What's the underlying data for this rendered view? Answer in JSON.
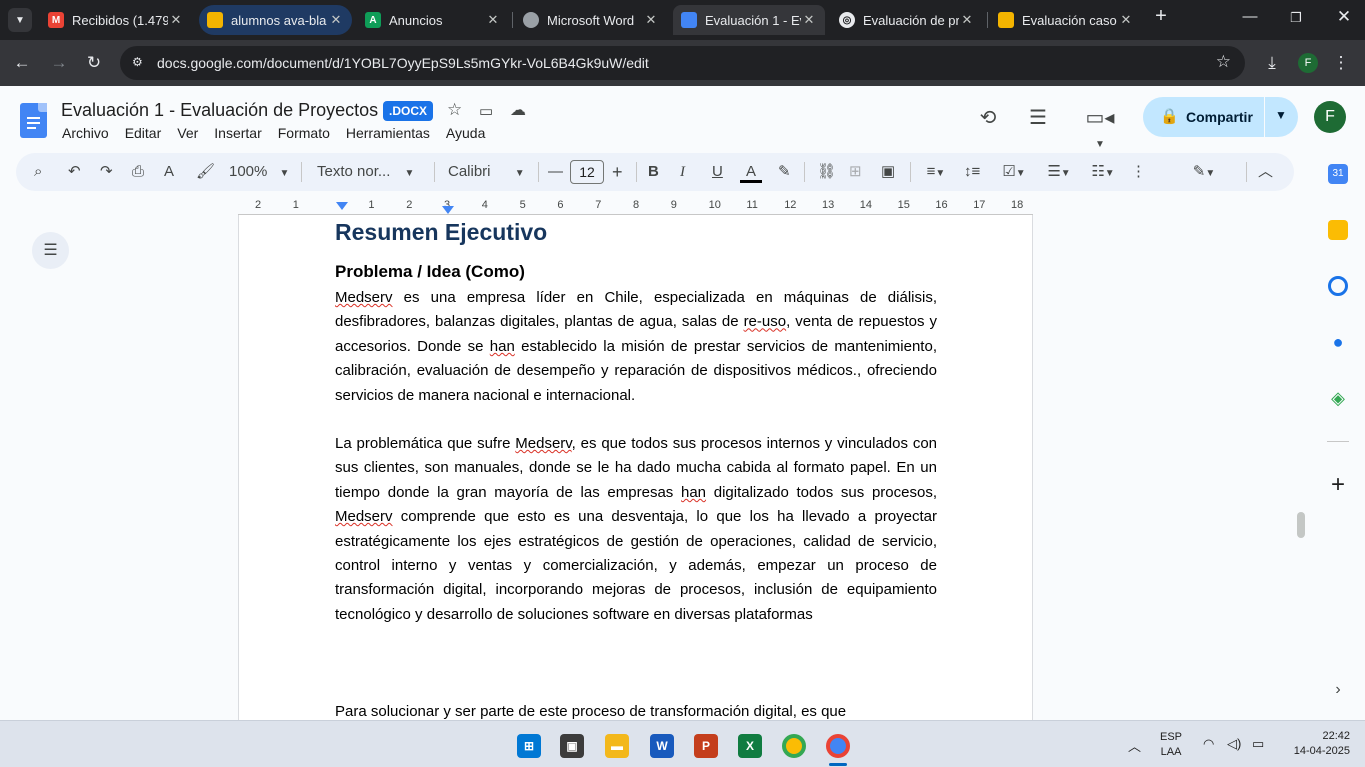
{
  "browser": {
    "tabs": [
      {
        "label": "Recibidos (1.479",
        "icon": "gmail-icon",
        "color": "#ea4335"
      },
      {
        "label": "alumnos ava-bla",
        "icon": "slides-icon",
        "color": "#f4b400"
      },
      {
        "label": "Anuncios",
        "icon": "classroom-icon",
        "color": "#0f9d58"
      },
      {
        "label": "Microsoft Word",
        "icon": "globe-icon",
        "color": "#9aa0a6"
      },
      {
        "label": "Evaluación 1 - Ev",
        "icon": "docs-icon",
        "color": "#4285f4"
      },
      {
        "label": "Evaluación de pr",
        "icon": "chatgpt-icon",
        "color": "#9aa0a6"
      },
      {
        "label": "Evaluación caso",
        "icon": "slides-icon",
        "color": "#f4b400"
      }
    ],
    "url": "docs.google.com/document/d/1YOBL7OyyEpS9Ls5mGYkr-VoL6B4Gk9uW/edit",
    "profile_initial": "F"
  },
  "docs": {
    "title": "Evaluación 1 - Evaluación de Proyectos",
    "badge": ".DOCX",
    "menu": [
      "Archivo",
      "Editar",
      "Ver",
      "Insertar",
      "Formato",
      "Herramientas",
      "Ayuda"
    ],
    "share_label": "Compartir",
    "avatar_initial": "F",
    "toolbar": {
      "zoom": "100%",
      "style": "Texto nor...",
      "font": "Calibri",
      "font_size": "12"
    },
    "ruler_ticks": [
      "2",
      "1",
      "",
      "1",
      "2",
      "3",
      "4",
      "5",
      "6",
      "7",
      "8",
      "9",
      "10",
      "11",
      "12",
      "13",
      "14",
      "15",
      "16",
      "17",
      "18"
    ]
  },
  "document": {
    "heading1": "Resumen Ejecutivo",
    "heading2": "Problema / Idea (Como)",
    "p1": "Medserv es una empresa líder en Chile, especializada en máquinas de diálisis, desfibradores, balanzas digitales, plantas de agua, salas de re-uso, venta de repuestos y accesorios. Donde se han establecido la misión de prestar servicios de mantenimiento, calibración, evaluación de desempeño y reparación de dispositivos médicos., ofreciendo servicios de manera nacional e internacional.",
    "p2": "La problemática que sufre Medserv, es que todos sus procesos internos y vinculados con sus clientes, son manuales, donde se le ha dado mucha cabida al formato papel. En un tiempo donde la gran mayoría de las empresas han digitalizado todos sus procesos, Medserv comprende que esto es una desventaja, lo que los ha llevado a proyectar estratégicamente los ejes estratégicos de gestión de operaciones, calidad de servicio, control interno y ventas y comercialización, y además, empezar un proceso de transformación digital, incorporando mejoras de procesos, inclusión de equipamiento tecnológico y desarrollo de soluciones software en diversas plataformas",
    "p3": "Para solucionar y ser parte de este proceso de transformación digital, es que"
  },
  "taskbar": {
    "lang_top": "ESP",
    "lang_bottom": "LAA",
    "time": "22:42",
    "date": "14-04-2025"
  }
}
